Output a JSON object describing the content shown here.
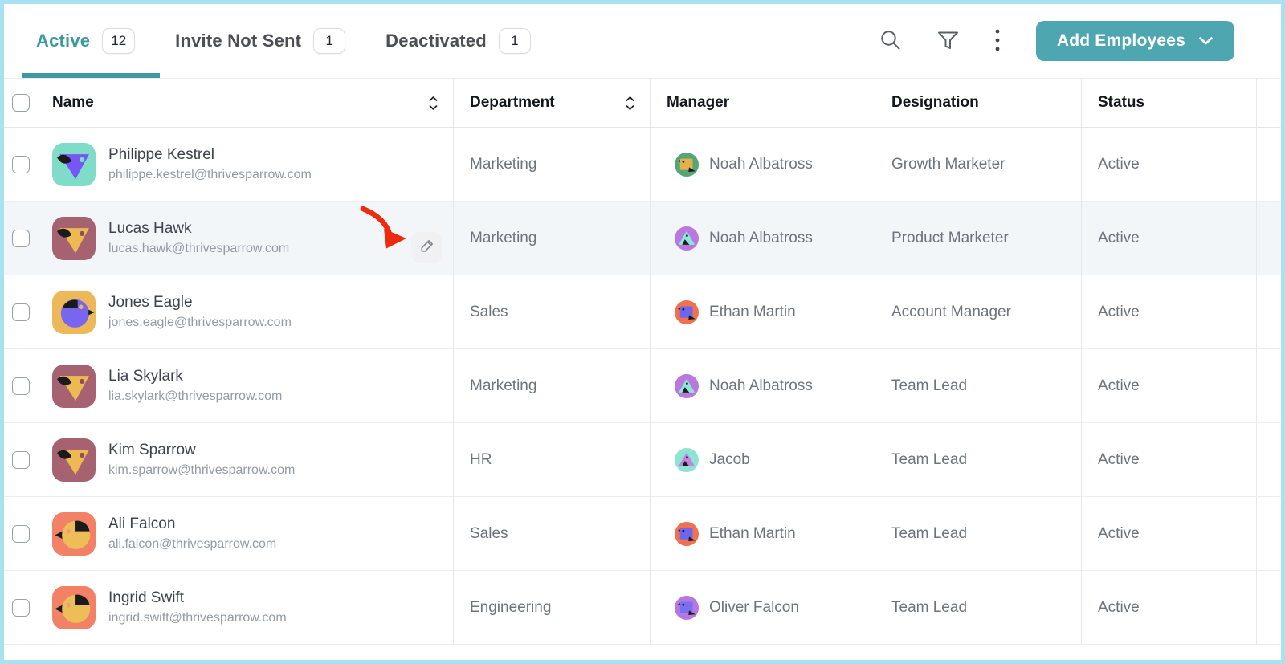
{
  "tabs": [
    {
      "id": "active",
      "label": "Active",
      "count": "12",
      "active": true
    },
    {
      "id": "invite-not-sent",
      "label": "Invite Not Sent",
      "count": "1",
      "active": false
    },
    {
      "id": "deactivated",
      "label": "Deactivated",
      "count": "1",
      "active": false
    }
  ],
  "toolbar": {
    "add_label": "Add Employees",
    "icons": [
      {
        "name": "search-icon"
      },
      {
        "name": "filter-icon"
      },
      {
        "name": "more-options-icon"
      }
    ]
  },
  "colors": {
    "accent_teal": "#4EA7B0",
    "active_tab": "#3E98A2",
    "frame_border": "#A9E1F3",
    "row_highlight": "#F2F6F9",
    "callout_red": "#EF2A0D"
  },
  "table": {
    "columns": [
      {
        "label": "Name",
        "sortable": true
      },
      {
        "label": "Department",
        "sortable": true
      },
      {
        "label": "Manager",
        "sortable": false
      },
      {
        "label": "Designation",
        "sortable": false
      },
      {
        "label": "Status",
        "sortable": false
      }
    ],
    "rows": [
      {
        "name": "Philippe Kestrel",
        "email": "philippe.kestrel@thrivesparrow.com",
        "avatar": {
          "bg": "#7FDCC9",
          "shape": "tri-down",
          "color": "#7656F4",
          "accent": "#7FDCC9"
        },
        "department": "Marketing",
        "manager": "Noah Albatross",
        "manager_avatar": {
          "bg": "#55A674",
          "shape": "square",
          "color": "#E2B14E"
        },
        "designation": "Growth Marketer",
        "status": "Active",
        "highlighted": false,
        "show_edit": false
      },
      {
        "name": "Lucas Hawk",
        "email": "lucas.hawk@thrivesparrow.com",
        "avatar": {
          "bg": "#A76271",
          "shape": "tri-down",
          "color": "#EDB953",
          "accent": "#8C4E5C"
        },
        "department": "Marketing",
        "manager": "Noah Albatross",
        "manager_avatar": {
          "bg": "#BA77DE",
          "shape": "tri-up",
          "color": "#8BE8D8"
        },
        "designation": "Product Marketer",
        "status": "Active",
        "highlighted": true,
        "show_edit": true
      },
      {
        "name": "Jones Eagle",
        "email": "jones.eagle@thrivesparrow.com",
        "avatar": {
          "bg": "#EDB858",
          "shape": "round-l",
          "color": "#7866F0",
          "accent": "#EDB858"
        },
        "department": "Sales",
        "manager": "Ethan Martin",
        "manager_avatar": {
          "bg": "#F07050",
          "shape": "square",
          "color": "#6D66EE"
        },
        "designation": "Account Manager",
        "status": "Active",
        "highlighted": false,
        "show_edit": false
      },
      {
        "name": "Lia Skylark",
        "email": "lia.skylark@thrivesparrow.com",
        "avatar": {
          "bg": "#A76271",
          "shape": "tri-down",
          "color": "#EDB953",
          "accent": "#8C4E5C"
        },
        "department": "Marketing",
        "manager": "Noah Albatross",
        "manager_avatar": {
          "bg": "#BA77DE",
          "shape": "tri-up",
          "color": "#8BE8D8"
        },
        "designation": "Team Lead",
        "status": "Active",
        "highlighted": false,
        "show_edit": false
      },
      {
        "name": "Kim Sparrow",
        "email": "kim.sparrow@thrivesparrow.com",
        "avatar": {
          "bg": "#A76271",
          "shape": "tri-down",
          "color": "#EDB953",
          "accent": "#8C4E5C"
        },
        "department": "HR",
        "manager": "Jacob",
        "manager_avatar": {
          "bg": "#8EE4D2",
          "shape": "tri-up",
          "color": "#C77FE3"
        },
        "designation": "Team Lead",
        "status": "Active",
        "highlighted": false,
        "show_edit": false
      },
      {
        "name": "Ali Falcon",
        "email": "ali.falcon@thrivesparrow.com",
        "avatar": {
          "bg": "#F28166",
          "shape": "round-r",
          "color": "#EDBE58",
          "accent": "#ED9A86"
        },
        "department": "Sales",
        "manager": "Ethan Martin",
        "manager_avatar": {
          "bg": "#F07050",
          "shape": "square",
          "color": "#6D66EE"
        },
        "designation": "Team Lead",
        "status": "Active",
        "highlighted": false,
        "show_edit": false
      },
      {
        "name": "Ingrid Swift",
        "email": "ingrid.swift@thrivesparrow.com",
        "avatar": {
          "bg": "#F28166",
          "shape": "round-r",
          "color": "#EDBE58",
          "accent": "#ED9A86"
        },
        "department": "Engineering",
        "manager": "Oliver Falcon",
        "manager_avatar": {
          "bg": "#B678E0",
          "shape": "square",
          "color": "#7A6FF0"
        },
        "designation": "Team Lead",
        "status": "Active",
        "highlighted": false,
        "show_edit": false
      }
    ]
  }
}
